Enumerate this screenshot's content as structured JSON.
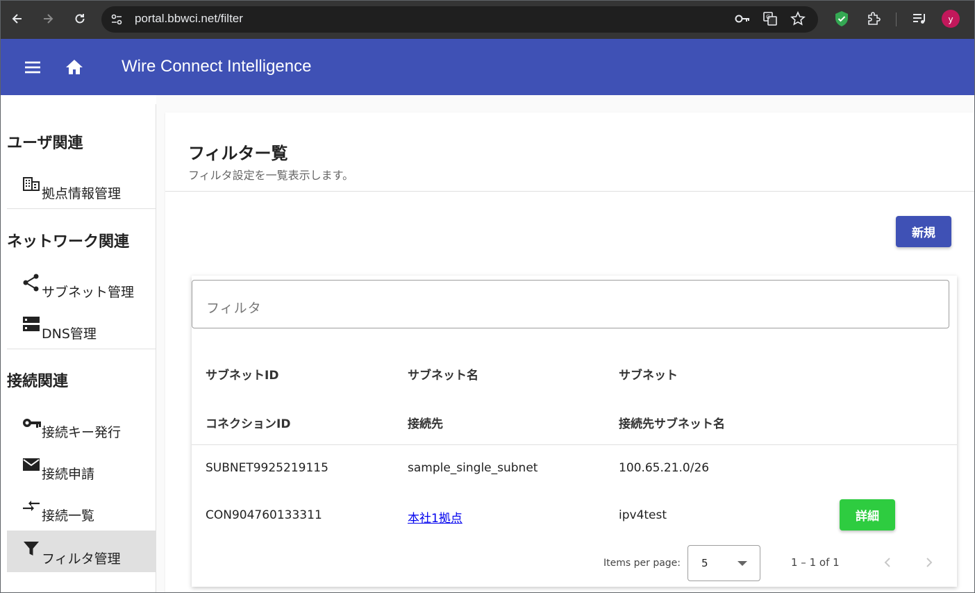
{
  "browser": {
    "url": "portal.bbwci.net/filter",
    "avatar_letter": "y"
  },
  "app": {
    "title": "Wire Connect Intelligence",
    "toolbar_color": "#3f51b5"
  },
  "sidebar": {
    "sections": [
      {
        "heading": "ユーザ関連"
      },
      {
        "heading": "ネットワーク関連"
      },
      {
        "heading": "接続関連"
      }
    ],
    "items": [
      {
        "label": "拠点情報管理",
        "icon": "domain-icon"
      },
      {
        "label": "サブネット管理",
        "icon": "share-icon"
      },
      {
        "label": "DNS管理",
        "icon": "dns-icon"
      },
      {
        "label": "接続キー発行",
        "icon": "key-icon"
      },
      {
        "label": "接続申請",
        "icon": "mail-icon"
      },
      {
        "label": "接続一覧",
        "icon": "compare-arrows-icon"
      },
      {
        "label": "フィルタ管理",
        "icon": "filter-icon",
        "active": true
      }
    ]
  },
  "page": {
    "title": "フィルター覧",
    "subtitle": "フィルタ設定を一覧表示します。",
    "new_button": "新規"
  },
  "filter": {
    "placeholder": "フィルタ"
  },
  "table": {
    "headers_row1": [
      "サブネットID",
      "サブネット名",
      "サブネット"
    ],
    "headers_row2": [
      "コネクションID",
      "接続先",
      "接続先サブネット名"
    ],
    "rows": [
      {
        "subnet_id": "SUBNET9925219115",
        "subnet_name": "sample_single_subnet",
        "subnet": "100.65.21.0/26",
        "connection_id": "CON904760133311",
        "destination": "本社1拠点",
        "destination_subnet_name": "ipv4test",
        "detail_button": "詳細"
      }
    ]
  },
  "paginator": {
    "items_per_page_label": "Items per page:",
    "page_size": "5",
    "range": "1 – 1 of 1"
  }
}
